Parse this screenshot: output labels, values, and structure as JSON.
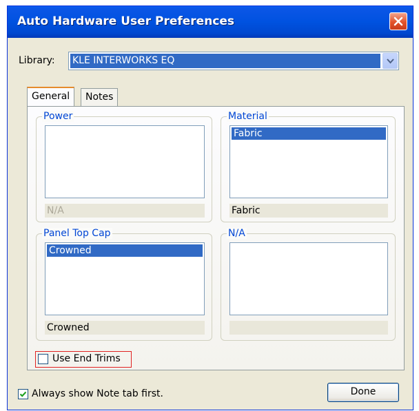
{
  "window": {
    "title": "Auto Hardware User Preferences"
  },
  "library": {
    "label": "Library:",
    "value": "KLE INTERWORKS EQ"
  },
  "tabs": [
    {
      "label": "General",
      "active": true
    },
    {
      "label": "Notes",
      "active": false
    }
  ],
  "groups": {
    "power": {
      "legend": "Power",
      "items": [],
      "status": "N/A",
      "status_enabled": false
    },
    "material": {
      "legend": "Material",
      "items": [
        "Fabric"
      ],
      "status": "Fabric",
      "status_enabled": true
    },
    "panel_top_cap": {
      "legend": "Panel Top Cap",
      "items": [
        "Crowned"
      ],
      "status": "Crowned",
      "status_enabled": true
    },
    "na": {
      "legend": "N/A",
      "items": [],
      "status": "",
      "status_enabled": false
    }
  },
  "use_end_trims": {
    "label": "Use End Trims",
    "checked": false
  },
  "always_show_note": {
    "label": "Always show Note tab first.",
    "checked": true
  },
  "done_button": {
    "label": "Done"
  },
  "colors": {
    "titlebar": "#0054e3",
    "selection": "#316ac5",
    "group_legend": "#0046d5",
    "dialog_bg": "#ece9d8"
  }
}
